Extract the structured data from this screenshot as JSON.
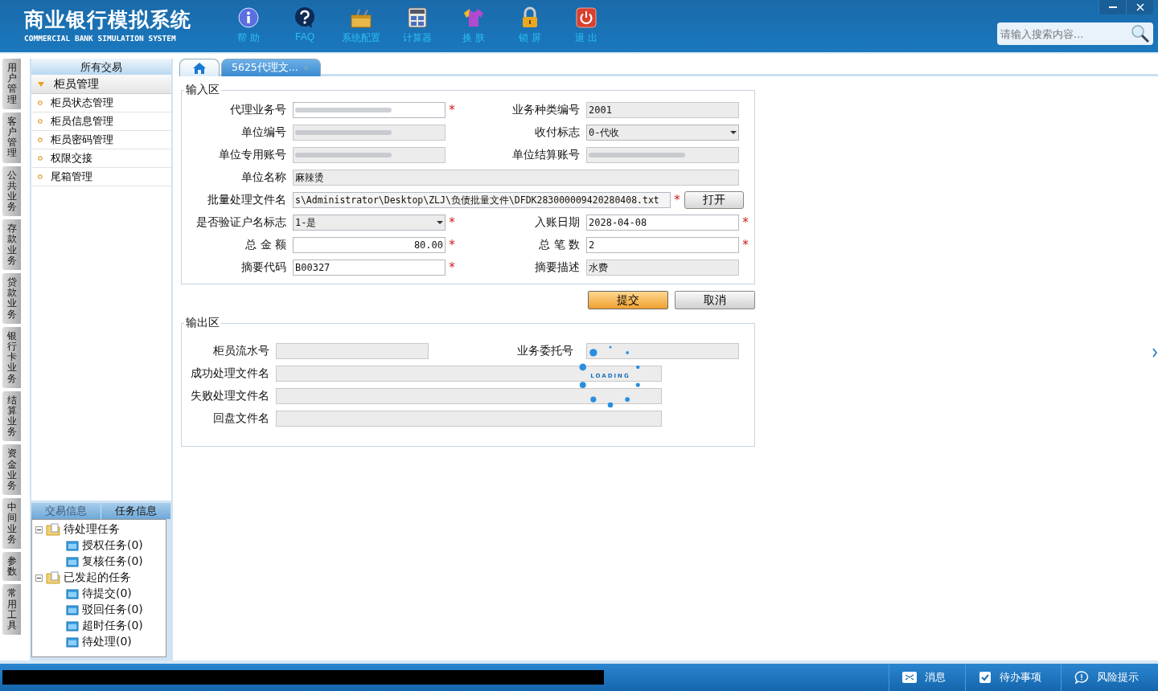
{
  "header": {
    "title": "商业银行模拟系统",
    "subtitle": "COMMERCIAL BANK SIMULATION SYSTEM",
    "toolbar": [
      {
        "label": "帮 助",
        "kind": "info"
      },
      {
        "label": "FAQ",
        "kind": "help"
      },
      {
        "label": "系统配置",
        "kind": "toolbox"
      },
      {
        "label": "计算器",
        "kind": "calculator"
      },
      {
        "label": "换 肤",
        "kind": "shirt"
      },
      {
        "label": "锁 屏",
        "kind": "lock"
      },
      {
        "label": "退 出",
        "kind": "power"
      }
    ],
    "search": {
      "placeholder": "请输入搜索内容..."
    }
  },
  "side_tabs": [
    "用户管理",
    "客户管理",
    "公共业务",
    "存款业务",
    "贷款业务",
    "银行卡业务",
    "结算业务",
    "资金业务",
    "中间业务",
    "参数",
    "常用工具"
  ],
  "sidebar": {
    "title": "所有交易",
    "group": {
      "label": "柜员管理",
      "expanded": true,
      "items": [
        "柜员状态管理",
        "柜员信息管理",
        "柜员密码管理",
        "权限交接",
        "尾箱管理"
      ]
    }
  },
  "info_panel": {
    "tabs": [
      {
        "label": "交易信息",
        "selected": false
      },
      {
        "label": "任务信息",
        "selected": true
      }
    ],
    "tree": [
      {
        "label": "待处理任务",
        "expanded": true,
        "children": [
          {
            "label": "授权任务(0)"
          },
          {
            "label": "复核任务(0)"
          }
        ]
      },
      {
        "label": "已发起的任务",
        "expanded": true,
        "children": [
          {
            "label": "待提交(0)"
          },
          {
            "label": "驳回任务(0)"
          },
          {
            "label": "超时任务(0)"
          },
          {
            "label": "待处理(0)"
          }
        ]
      }
    ]
  },
  "tabs": [
    {
      "kind": "home",
      "selected": false
    },
    {
      "kind": "page",
      "label": "5625代理文...",
      "selected": true
    }
  ],
  "input_area": {
    "title": "输入区",
    "fields": [
      {
        "label": "代理业务号",
        "kind": "input",
        "redacted": true,
        "required": "*"
      },
      {
        "label": "业务种类编号",
        "kind": "readonly",
        "value": "2001"
      },
      {
        "label": "单位编号",
        "kind": "readonly",
        "redacted": true
      },
      {
        "label": "收付标志",
        "kind": "select",
        "value": "0-代收"
      },
      {
        "label": "单位专用账号",
        "kind": "readonly",
        "redacted": true
      },
      {
        "label": "单位结算账号",
        "kind": "readonly",
        "redacted": true
      },
      {
        "label": "单位名称",
        "kind": "wide_readonly",
        "value": "麻辣烫"
      },
      {
        "label": "批量处理文件名",
        "kind": "file",
        "value": "s\\Administrator\\Desktop\\ZLJ\\负债批量文件\\DFDK283000009420280408.txt",
        "required": "*",
        "button": "打开"
      },
      {
        "label": "是否验证户名标志",
        "kind": "select",
        "value": "1-是",
        "required": "*"
      },
      {
        "label": "入账日期",
        "kind": "input",
        "value": "2028-04-08",
        "required": "*"
      },
      {
        "label": "总 金 额",
        "kind": "amount",
        "value": "80.00",
        "required": "*"
      },
      {
        "label": "总 笔 数",
        "kind": "input",
        "value": "2",
        "required": "*"
      },
      {
        "label": "摘要代码",
        "kind": "input",
        "value": "B00327",
        "required": "*"
      },
      {
        "label": "摘要描述",
        "kind": "readonly",
        "value": "水费"
      }
    ]
  },
  "buttons": [
    {
      "label": "提交",
      "primary": true
    },
    {
      "label": "取消",
      "primary": false
    }
  ],
  "output_area": {
    "title": "输出区",
    "fields": [
      {
        "label": "柜员流水号",
        "kind": "short"
      },
      {
        "label": "业务委托号",
        "kind": "short"
      },
      {
        "label": "成功处理文件名",
        "kind": "long"
      },
      {
        "label": "失败处理文件名",
        "kind": "long"
      },
      {
        "label": "回盘文件名",
        "kind": "long"
      }
    ]
  },
  "loading": {
    "text": "LOADING"
  },
  "status_bar": [
    {
      "label": "消息",
      "kind": "mail"
    },
    {
      "label": "待办事项",
      "kind": "check"
    },
    {
      "label": "风险提示",
      "kind": "alert"
    }
  ]
}
